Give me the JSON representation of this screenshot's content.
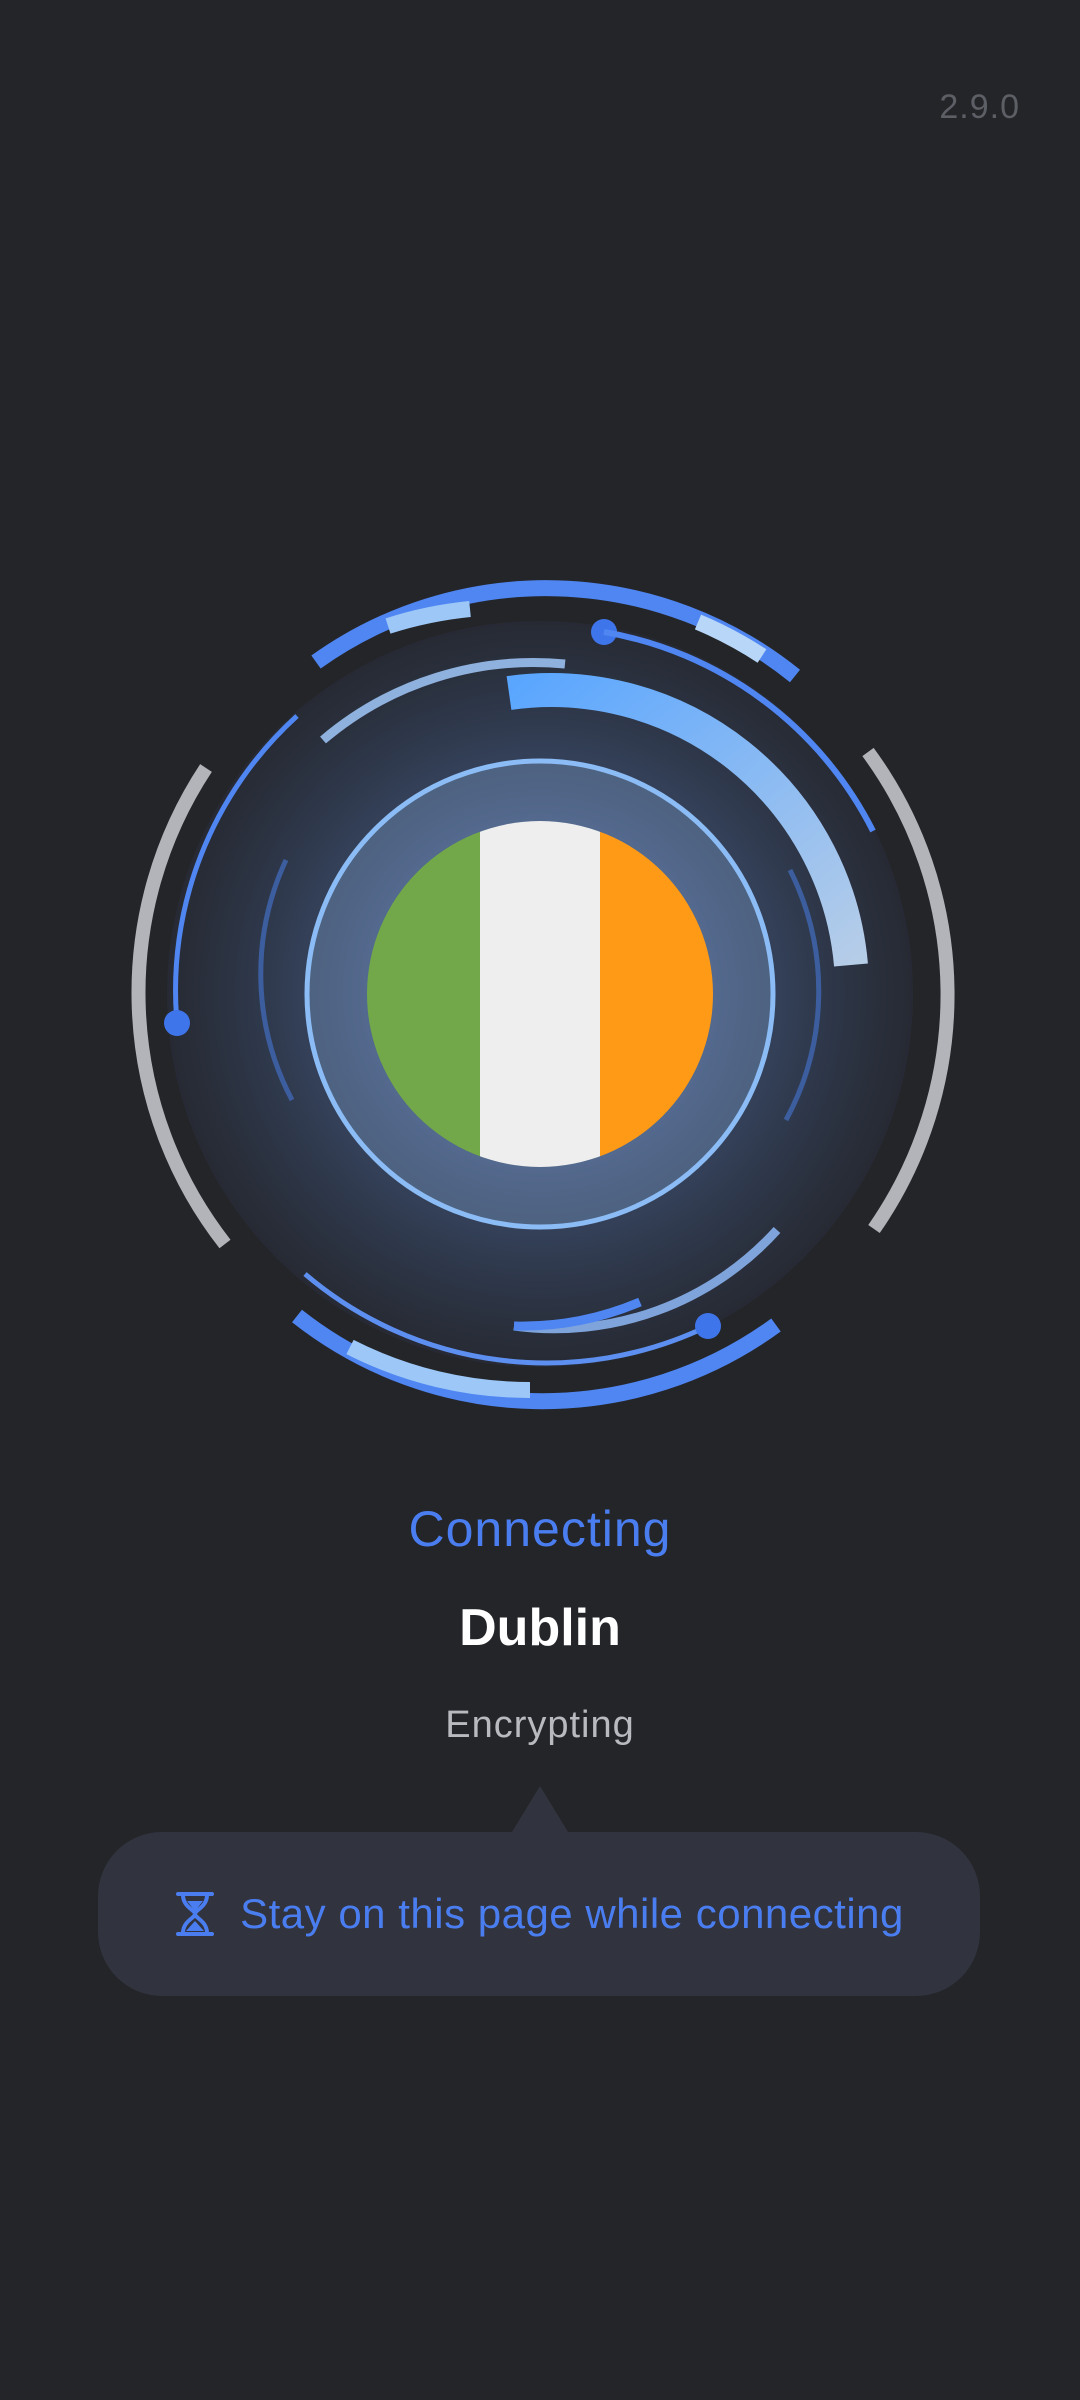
{
  "app": {
    "version": "2.9.0"
  },
  "connection": {
    "status": "Connecting",
    "city": "Dublin",
    "stage": "Encrypting",
    "country_flag": {
      "icon": "ireland-flag-icon",
      "colors": [
        "#72a84a",
        "#eeeeee",
        "#ff9a17"
      ]
    }
  },
  "notice": {
    "icon": "hourglass-icon",
    "text": "Stay on this page while connecting"
  },
  "theme": {
    "accent": "#4a7ef0",
    "background": "#242529",
    "panel": "#31333f"
  }
}
